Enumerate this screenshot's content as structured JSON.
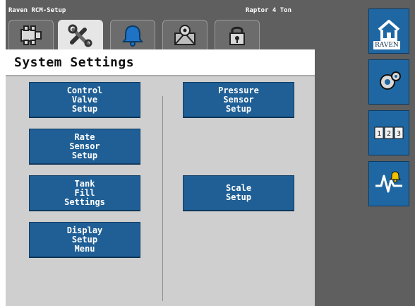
{
  "titlebar": {
    "app": "Raven RCM-Setup",
    "machine": "Raptor 4 Ton"
  },
  "tabs": [
    {
      "name": "machine-settings-tab",
      "icon": "machine-icon",
      "active": false
    },
    {
      "name": "tools-tab",
      "icon": "tools-icon",
      "active": true
    },
    {
      "name": "alarms-tab",
      "icon": "bell-icon",
      "active": false
    },
    {
      "name": "calibration-tab",
      "icon": "field-settings-icon",
      "active": false
    },
    {
      "name": "security-tab",
      "icon": "lock-icon",
      "active": false
    }
  ],
  "header": {
    "title": "System Settings"
  },
  "buttons": {
    "control_valve_setup": "Control\nValve\nSetup",
    "rate_sensor_setup": "Rate\nSensor\nSetup",
    "tank_fill_settings": "Tank\nFill\nSettings",
    "display_setup_menu": "Display\nSetup\nMenu",
    "pressure_sensor_setup": "Pressure\nSensor\nSetup",
    "scale_setup": "Scale\nSetup"
  },
  "sidebar": {
    "home": {
      "icon": "home-icon",
      "logo": "RAVEN"
    },
    "settings": {
      "icon": "gear-icon"
    },
    "keypad": {
      "icon": "keypad-icon",
      "text": "1 2 3"
    },
    "diagnostics": {
      "icon": "alert-diagnostics-icon"
    }
  },
  "colors": {
    "accent": "#1f5f96",
    "panel": "#cfcfcf",
    "chrome": "#5f5f5f",
    "sidebar": "#1e67a3"
  }
}
